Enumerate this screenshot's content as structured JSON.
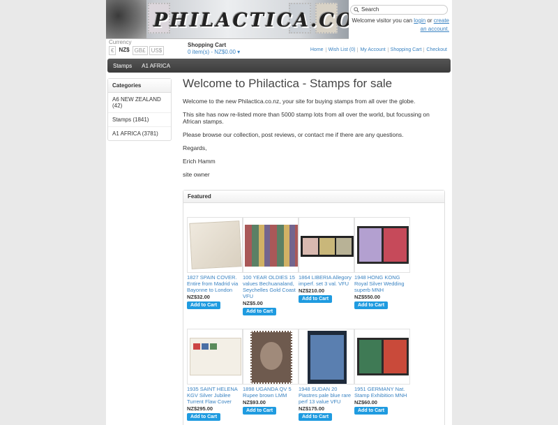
{
  "header": {
    "logo_text": "PHILACTICA.CO.NZ",
    "search_placeholder": "Search",
    "welcome_prefix": "Welcome visitor you can",
    "login_link": "login",
    "or_text": "or",
    "create_account_link": "create an account."
  },
  "currency": {
    "label": "Currency",
    "options": [
      "€",
      "NZ$",
      "GB£",
      "US$"
    ],
    "selected": "NZ$"
  },
  "cart": {
    "title": "Shopping Cart",
    "summary": "0 item(s) - NZ$0.00"
  },
  "top_links": [
    "Home",
    "Wish List (0)",
    "My Account",
    "Shopping Cart",
    "Checkout"
  ],
  "menu": [
    "Stamps",
    "A1 AFRICA"
  ],
  "sidebar": {
    "title": "Categories",
    "items": [
      "A6 NEW ZEALAND (42)",
      "Stamps (1841)",
      "A1 AFRICA (3781)"
    ]
  },
  "main": {
    "title": "Welcome to Philactica - Stamps for sale",
    "paragraphs": [
      "Welcome to the new Philactica.co.nz, your site for buying stamps from all over the globe.",
      "This site has now re-listed more than 5000 stamp lots from all over the world, but focussing on African stamps.",
      "Please browse our collection, post reviews, or contact me if there are any questions.",
      "Regards,",
      "Erich Hamm",
      "site owner"
    ]
  },
  "featured": {
    "title": "Featured",
    "button_label": "Add to Cart",
    "products": [
      {
        "name": "1827 SPAIN COVER. Entire from Madrid via Bayonne to London",
        "price": "NZ$32.00"
      },
      {
        "name": "100 YEAR OLDIES 15 values Bechuanaland, Seychelles Gold Coast VFU",
        "price": "NZ$5.00"
      },
      {
        "name": "1864 LIBERIA Allegory imperf. set 3 val. VFU",
        "price": "NZ$210.00"
      },
      {
        "name": "1948 HONG KONG Royal Silver Wedding superb MNH",
        "price": "NZ$550.00"
      },
      {
        "name": "1935 SAINT HELENA KGV Silver Jubilee Turrent Flaw Cover",
        "price": "NZ$295.00"
      },
      {
        "name": "1898 UGANDA QV 5 Rupee brown LMM",
        "price": "NZ$93.00"
      },
      {
        "name": "1948 SUDAN 20 Piastres pale blue rare perf 13 value VFU",
        "price": "NZ$175.00"
      },
      {
        "name": "1951 GERMANY Nat. Stamp Exhibition MNH",
        "price": "NZ$60.00"
      }
    ]
  }
}
